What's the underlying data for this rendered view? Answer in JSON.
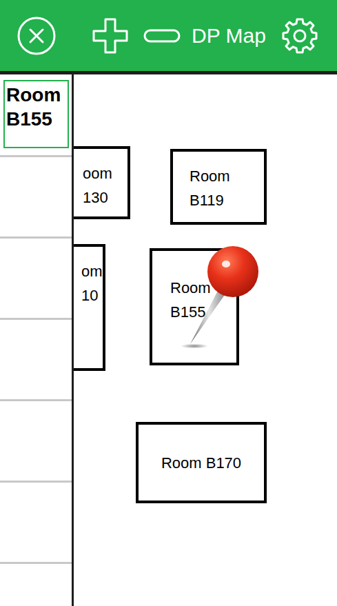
{
  "window": {
    "title": "DP Map"
  },
  "sidebar": {
    "items": [
      {
        "label": "Room B155",
        "selected": true
      },
      {
        "label": "",
        "selected": false
      },
      {
        "label": "",
        "selected": false
      },
      {
        "label": "",
        "selected": false
      },
      {
        "label": "",
        "selected": false
      },
      {
        "label": "",
        "selected": false
      },
      {
        "label": "",
        "selected": false
      }
    ]
  },
  "map": {
    "rooms": [
      {
        "lines": [
          "oom",
          "130"
        ],
        "pinned": false
      },
      {
        "lines": [
          "om",
          "10"
        ],
        "pinned": false
      },
      {
        "lines": [
          "Room",
          "B119"
        ],
        "pinned": false
      },
      {
        "lines": [
          "Room",
          "B155"
        ],
        "pinned": true
      },
      {
        "lines": [
          "Room B170"
        ],
        "pinned": false
      }
    ]
  }
}
